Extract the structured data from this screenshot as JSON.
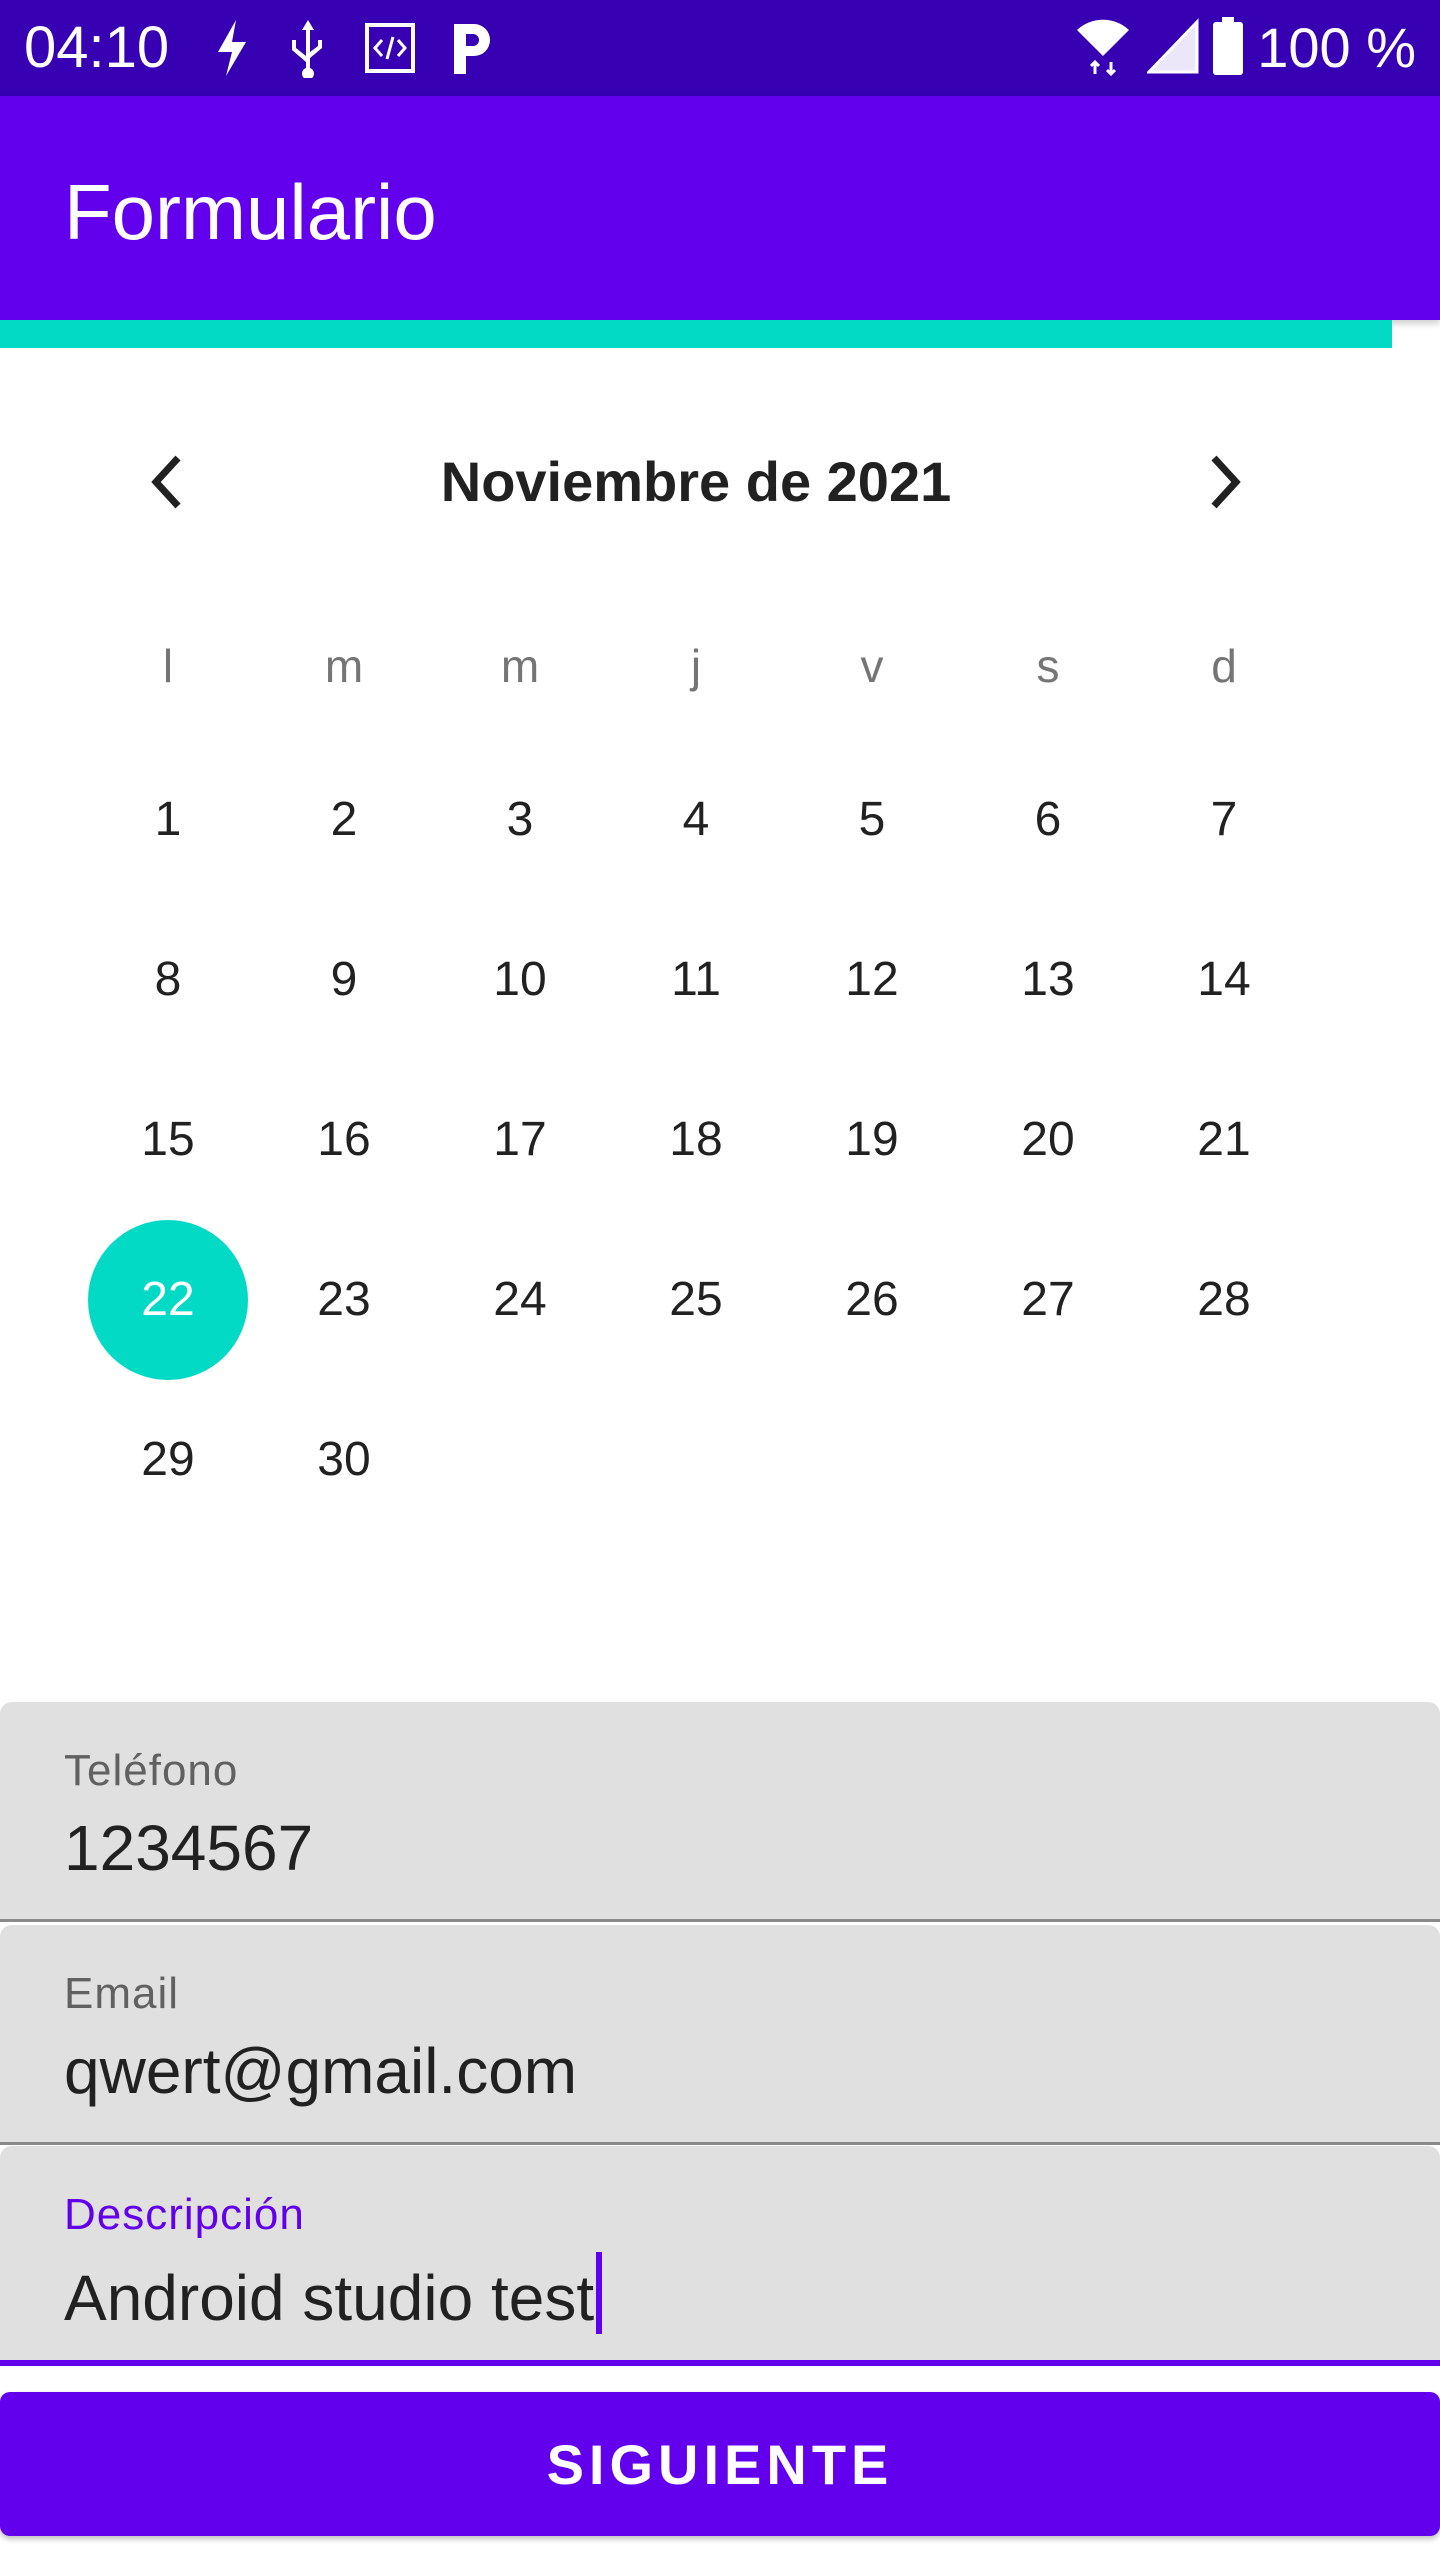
{
  "status_bar": {
    "time": "04:10",
    "battery": "100 %",
    "icons": [
      "flash-icon",
      "usb-icon",
      "code-icon",
      "p-icon",
      "wifi-icon",
      "signal-icon",
      "battery-icon"
    ]
  },
  "app_bar": {
    "title": "Formulario"
  },
  "colors": {
    "primary": "#6200ee",
    "primary_dark": "#3700b3",
    "accent": "#03dac5"
  },
  "calendar": {
    "month_label": "Noviembre de 2021",
    "weekdays": [
      "l",
      "m",
      "m",
      "j",
      "v",
      "s",
      "d"
    ],
    "weeks": [
      [
        "1",
        "2",
        "3",
        "4",
        "5",
        "6",
        "7"
      ],
      [
        "8",
        "9",
        "10",
        "11",
        "12",
        "13",
        "14"
      ],
      [
        "15",
        "16",
        "17",
        "18",
        "19",
        "20",
        "21"
      ],
      [
        "22",
        "23",
        "24",
        "25",
        "26",
        "27",
        "28"
      ],
      [
        "29",
        "30",
        "",
        "",
        "",
        "",
        ""
      ]
    ],
    "selected_day": "22"
  },
  "form": {
    "phone": {
      "label": "Teléfono",
      "value": "1234567"
    },
    "email": {
      "label": "Email",
      "value": "qwert@gmail.com"
    },
    "description": {
      "label": "Descripción",
      "value": "Android studio test"
    }
  },
  "button": {
    "label": "SIGUIENTE"
  }
}
